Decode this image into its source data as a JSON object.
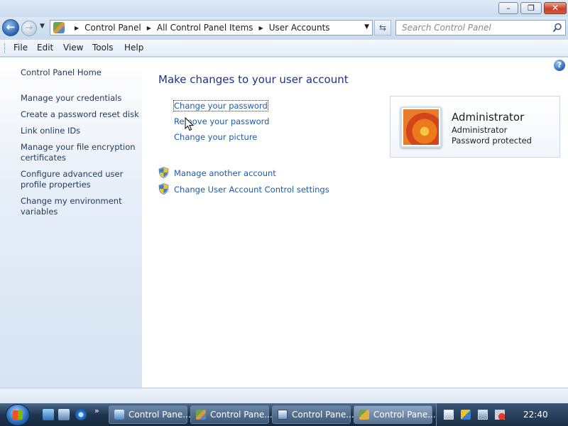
{
  "window": {
    "minimize_glyph": "–",
    "maximize_glyph": "❐",
    "close_glyph": "✕"
  },
  "navigation": {
    "back_glyph": "←",
    "forward_glyph": "→",
    "breadcrumbs": [
      "Control Panel",
      "All Control Panel Items",
      "User Accounts"
    ],
    "search_placeholder": "Search Control Panel"
  },
  "menubar": {
    "items": [
      "File",
      "Edit",
      "View",
      "Tools",
      "Help"
    ]
  },
  "sidebar": {
    "items": [
      {
        "label": "Control Panel Home"
      },
      {
        "label": "Manage your credentials"
      },
      {
        "label": "Create a password reset disk"
      },
      {
        "label": "Link online IDs"
      },
      {
        "label": "Manage your file encryption certificates"
      },
      {
        "label": "Configure advanced user profile properties"
      },
      {
        "label": "Change my environment variables"
      }
    ]
  },
  "main": {
    "heading": "Make changes to your user account",
    "links": [
      {
        "label": "Change your password"
      },
      {
        "label": "Remove your password"
      },
      {
        "label": "Change your picture"
      }
    ],
    "admin_links": [
      {
        "label": "Manage another account"
      },
      {
        "label": "Change User Account Control settings"
      }
    ],
    "account": {
      "name": "Administrator",
      "role": "Administrator",
      "status": "Password protected"
    }
  },
  "taskbar": {
    "quicklaunch_more": "»",
    "buttons": [
      {
        "label": "Control Pane...",
        "icon": "computer-icon"
      },
      {
        "label": "Control Pane...",
        "icon": "control-panel-icon"
      },
      {
        "label": "Control Pane...",
        "icon": "mail-icon"
      },
      {
        "label": "Control Pane...",
        "icon": "users-icon"
      }
    ],
    "clock": "22:40"
  },
  "colors": {
    "link": "#1e5aa8",
    "heading": "#1e3287",
    "sidebar_text": "#1e395b"
  }
}
